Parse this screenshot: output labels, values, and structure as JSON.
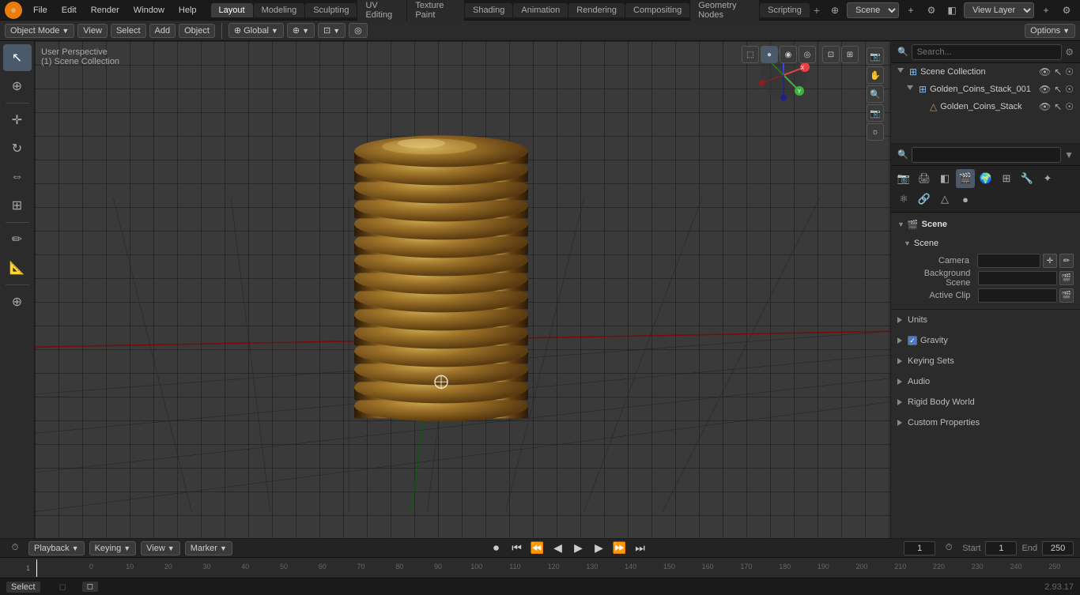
{
  "app": {
    "title": "Blender",
    "version": "2.93.17"
  },
  "menubar": {
    "items": [
      "File",
      "Edit",
      "Render",
      "Window",
      "Help"
    ],
    "logo_color": "#e87d0d"
  },
  "workspace_tabs": {
    "tabs": [
      "Layout",
      "Modeling",
      "Sculpting",
      "UV Editing",
      "Texture Paint",
      "Shading",
      "Animation",
      "Rendering",
      "Compositing",
      "Geometry Nodes",
      "Scripting"
    ],
    "active": "Layout"
  },
  "top_right": {
    "scene_label": "Scene",
    "view_layer_label": "View Layer"
  },
  "viewport": {
    "perspective_label": "User Perspective",
    "collection_label": "(1) Scene Collection",
    "mode": "Object Mode",
    "view_label": "View",
    "select_label": "Select",
    "add_label": "Add",
    "object_label": "Object",
    "global_label": "Global"
  },
  "header_toolbar": {
    "mode": "Object Mode",
    "view": "View",
    "select": "Select",
    "add": "Add",
    "object": "Object",
    "global": "Global",
    "options": "Options"
  },
  "outliner": {
    "title": "Scene Collection",
    "items": [
      {
        "name": "Golden_Coins_Stack_001",
        "indent": 1,
        "icon": "collection",
        "expanded": true,
        "children": [
          {
            "name": "Golden_Coins_Stack",
            "indent": 2,
            "icon": "mesh"
          }
        ]
      }
    ]
  },
  "properties": {
    "title": "Scene",
    "icon": "scene",
    "tabs": [
      "render",
      "output",
      "view_layer",
      "scene",
      "world",
      "object",
      "modifier",
      "particles",
      "physics",
      "constraints",
      "data",
      "material",
      "texture",
      "node"
    ],
    "active_tab": "scene",
    "scene_section": {
      "label": "Scene",
      "camera_label": "Camera",
      "camera_value": "",
      "background_scene_label": "Background Scene",
      "background_scene_value": "",
      "active_clip_label": "Active Clip",
      "active_clip_value": ""
    },
    "units_label": "Units",
    "gravity_label": "Gravity",
    "gravity_checked": true,
    "keying_sets_label": "Keying Sets",
    "audio_label": "Audio",
    "rigid_body_world_label": "Rigid Body World",
    "custom_properties_label": "Custom Properties"
  },
  "timeline": {
    "playback_label": "Playback",
    "keying_label": "Keying",
    "view_label": "View",
    "marker_label": "Marker",
    "frame_current": "1",
    "frame_start_label": "Start",
    "frame_start": "1",
    "frame_end_label": "End",
    "frame_end": "250",
    "frame_numbers": [
      "0",
      "10",
      "20",
      "30",
      "40",
      "50",
      "60",
      "70",
      "80",
      "90",
      "100",
      "110",
      "120",
      "130",
      "140",
      "150",
      "160",
      "170",
      "180",
      "190",
      "200",
      "210",
      "220",
      "230",
      "240",
      "250"
    ]
  },
  "status_bar": {
    "select_label": "Select",
    "version": "2.93.17",
    "right_text": ""
  },
  "icons": {
    "search": "🔍",
    "funnel": "⚙",
    "camera": "📷",
    "scene_icon": "🎬",
    "mesh_icon": "△",
    "collection_icon": "⊞",
    "eye": "👁",
    "cursor": "⊕",
    "move": "✛",
    "rotate": "↻",
    "scale": "⇔",
    "transform": "⊕",
    "annotate": "✏",
    "measure": "📐",
    "add_icon": "⊕",
    "playback_start": "⏮",
    "playback_prev": "⏭",
    "playback_stepback": "◀",
    "playback_play": "▶",
    "playback_stepfwd": "▶▶",
    "playback_end": "⏭"
  }
}
